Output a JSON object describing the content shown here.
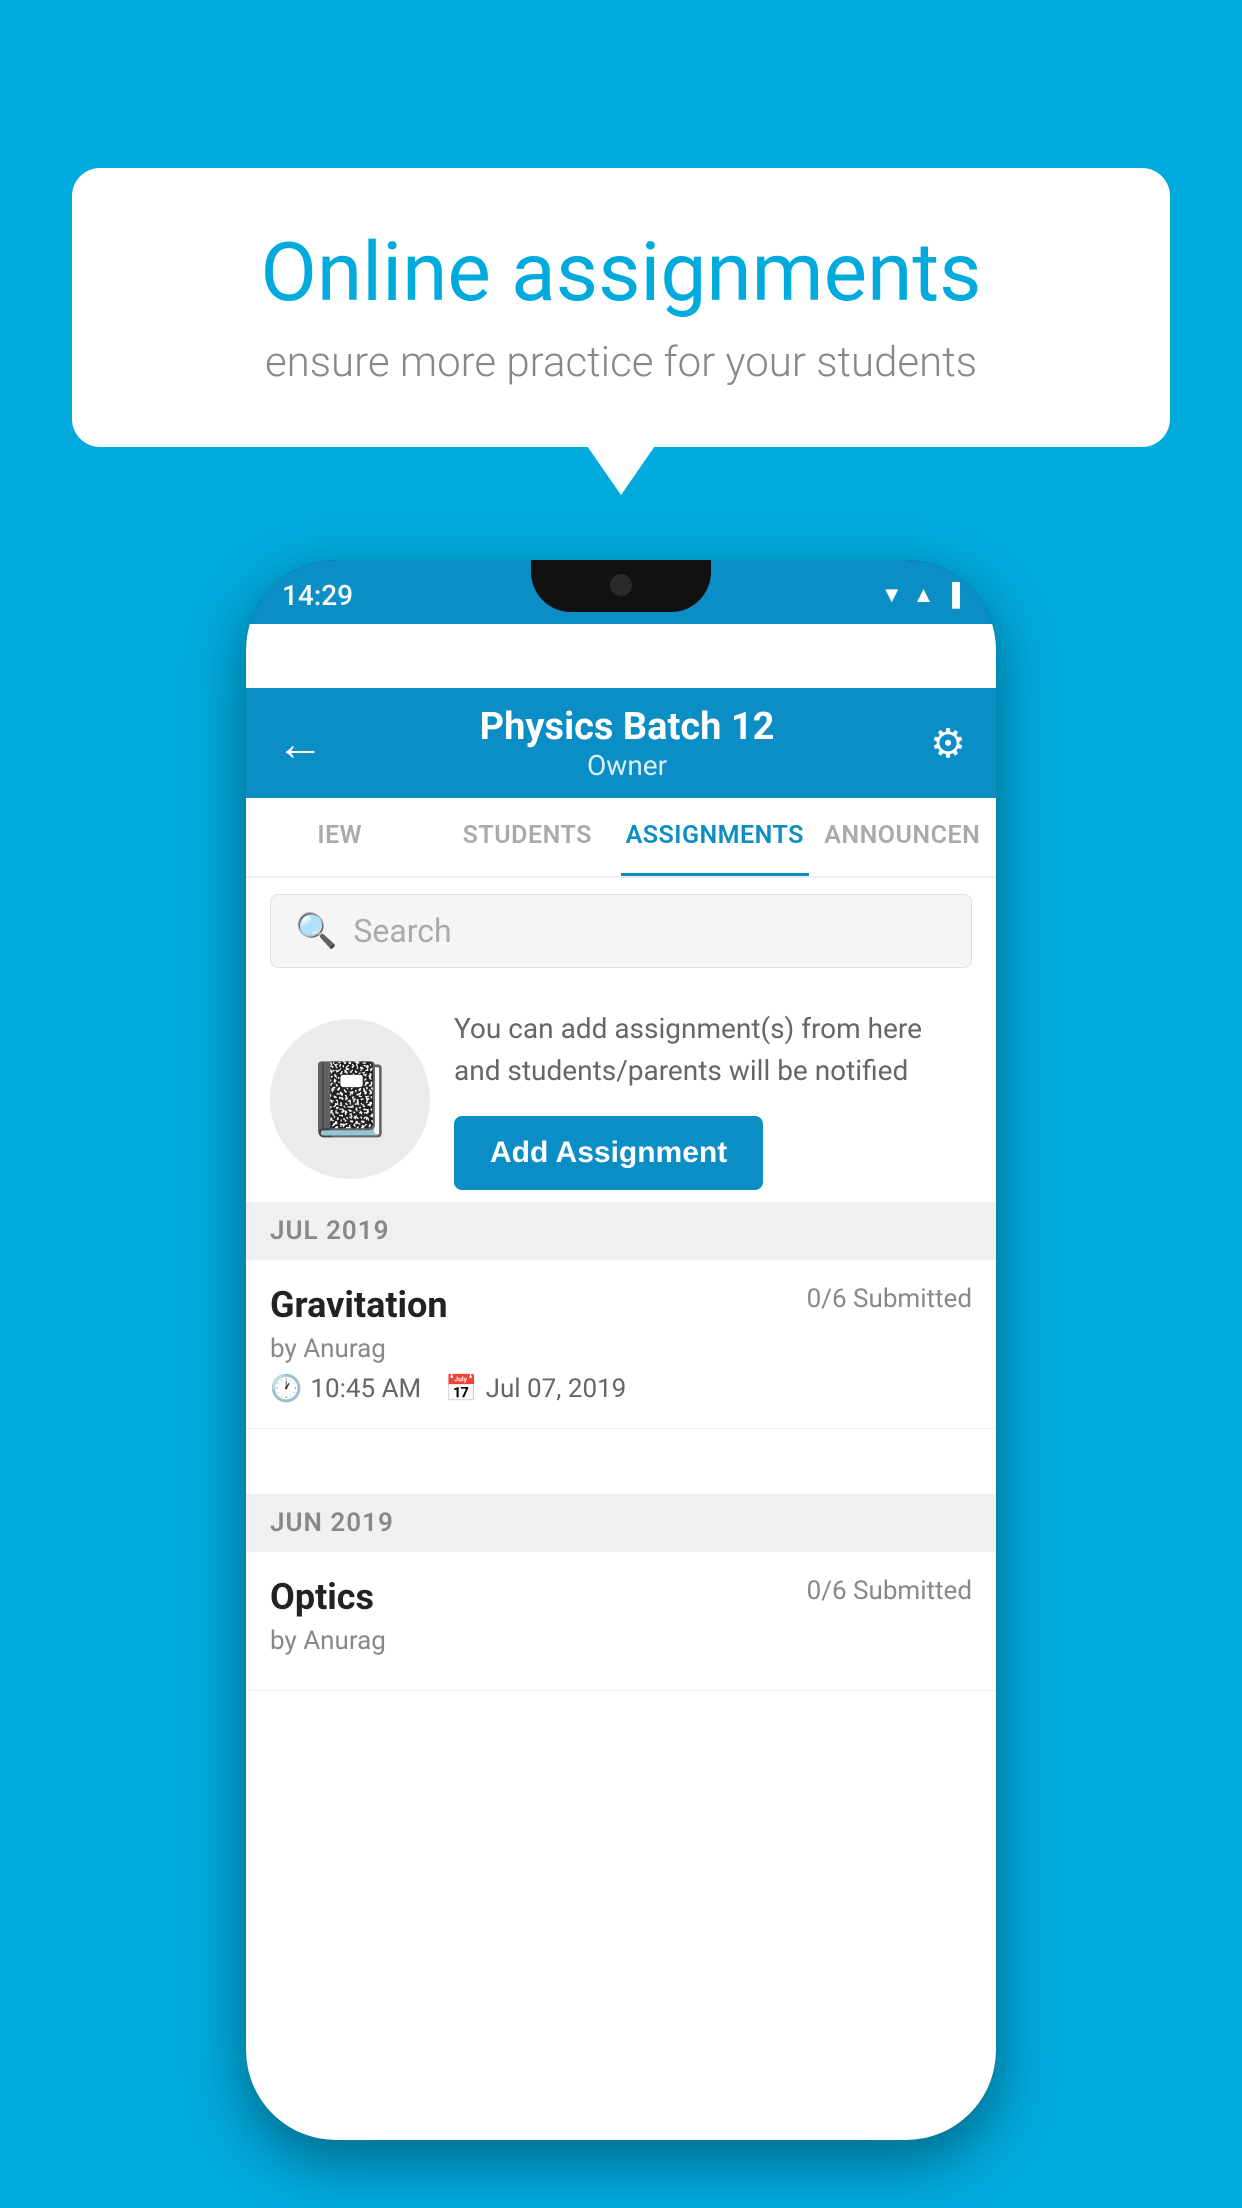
{
  "page": {
    "bg_color": "#00AADD"
  },
  "bubble": {
    "title": "Online assignments",
    "subtitle": "ensure more practice for your students"
  },
  "status_bar": {
    "time": "14:29"
  },
  "app_bar": {
    "title": "Physics Batch 12",
    "subtitle": "Owner",
    "back_label": "←",
    "settings_label": "⚙"
  },
  "tabs": [
    {
      "label": "IEW",
      "active": false
    },
    {
      "label": "STUDENTS",
      "active": false
    },
    {
      "label": "ASSIGNMENTS",
      "active": true
    },
    {
      "label": "ANNOUNCEN",
      "active": false
    }
  ],
  "search": {
    "placeholder": "Search"
  },
  "promo": {
    "description": "You can add assignment(s) from here and students/parents will be notified",
    "button_label": "Add Assignment"
  },
  "sections": [
    {
      "month_label": "JUL 2019",
      "assignments": [
        {
          "name": "Gravitation",
          "submitted": "0/6 Submitted",
          "by": "by Anurag",
          "time": "10:45 AM",
          "date": "Jul 07, 2019"
        }
      ]
    },
    {
      "month_label": "JUN 2019",
      "assignments": [
        {
          "name": "Optics",
          "submitted": "0/6 Submitted",
          "by": "by Anurag",
          "time": "",
          "date": ""
        }
      ]
    }
  ]
}
